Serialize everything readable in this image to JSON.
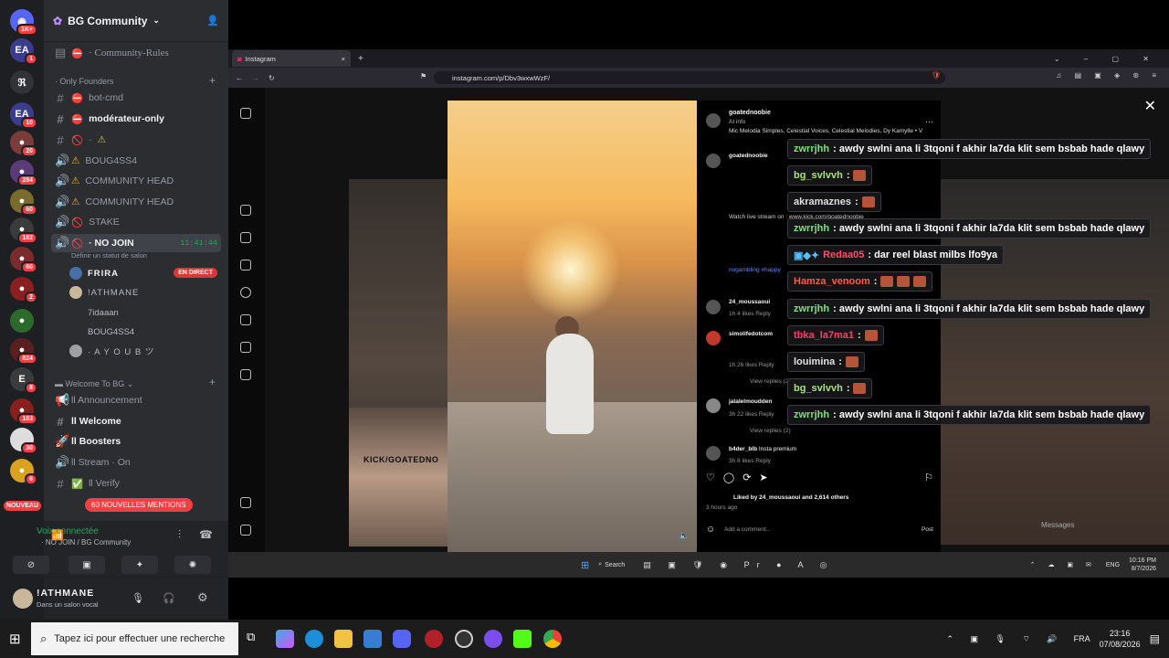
{
  "discord": {
    "guild_name": "BG Community",
    "channels": [
      {
        "name": "· Community-Rules",
        "icon": "rules-icon",
        "prefix": "⛔"
      },
      {
        "category": "· Only Founders"
      },
      {
        "name": "bot-cmd",
        "icon": "hash-icon",
        "prefix": "⛔"
      },
      {
        "name": "modérateur-only",
        "icon": "hash-icon",
        "prefix": "⛔",
        "bright": true
      },
      {
        "name": "·",
        "icon": "hash-icon",
        "prefix": "🚫",
        "extra": "⚠"
      },
      {
        "name": "BOUG4SS4",
        "icon": "speaker-icon",
        "prefix": "⚠"
      },
      {
        "name": "COMMUNITY HEAD",
        "icon": "speaker-icon",
        "prefix": "⚠"
      },
      {
        "name": "COMMUNITY HEAD",
        "icon": "speaker-icon",
        "prefix": "⚠"
      },
      {
        "name": "STAKE",
        "icon": "speaker-icon",
        "prefix": "🚫"
      },
      {
        "name": "· NO JOIN",
        "icon": "speaker-icon",
        "prefix": "🚫",
        "bright": true,
        "time": "11:41:44",
        "status": "Définir un statut de salon"
      }
    ],
    "voice_users": [
      {
        "name": "FRIRA",
        "live": "EN DIRECT"
      },
      {
        "name": "!ATHMANE"
      },
      {
        "name": "7idaaan"
      },
      {
        "name": "BOUG4SS4"
      },
      {
        "name": "· A Y O U B ツ"
      }
    ],
    "category2": "Welcome To BG",
    "channels2": [
      {
        "name": "ll Announcement",
        "icon": "announcement-icon"
      },
      {
        "name": "ll Welcome",
        "icon": "hash-icon"
      },
      {
        "name": "ll Boosters",
        "icon": "rocket-icon"
      },
      {
        "name": "ll Stream · On",
        "icon": "speaker-icon"
      },
      {
        "name": "ll Verify",
        "icon": "check-icon"
      }
    ],
    "mentions_pill": "60 NOUVELLES MENTIONS",
    "new_badge": "NOUVEAU",
    "voice_connected": "Voix connectée",
    "voice_channel": "· NO JOIN / BG Community",
    "user_name": "!ATHMANE",
    "user_status": "Dans un salon vocal",
    "server_badges": [
      "1K+",
      "1",
      "",
      "10",
      "20",
      "284",
      "60",
      "182",
      "60",
      "2",
      "824",
      "8",
      "183",
      "30",
      "6"
    ]
  },
  "browser": {
    "tab_title": "Instagram",
    "url": "instagram.com/p/Dbv3wxwWzF/",
    "post": {
      "author": "goatednoobie",
      "audio": "AI info",
      "music": "Mic Melodia Simples, Celestial Voices, Celestial Melodies, Dy Kamylle • V",
      "caption_user": "goatednoobie",
      "watch_live": "Watch live stream on : www.kick.com/goatednoobie",
      "hashtags": "nogambling #happy",
      "comments": [
        {
          "user": "24_moussaoui",
          "meta": "1h   4 likes   Reply"
        },
        {
          "user": "simolifedotcom",
          "meta": "1h   26 likes   Reply"
        },
        {
          "user": "jalalelmoudden",
          "meta": "3h   22 likes   Reply"
        },
        {
          "user": "b4der_blb",
          "text": "Insta premium",
          "meta": "3h   8 likes   Reply"
        }
      ],
      "view_replies": "View replies (2)",
      "liked_by": "Liked by 24_moussaoui and 2,614 others",
      "time_ago": "3 hours ago",
      "add_comment": "Add a comment...",
      "post_btn": "Post",
      "messages": "Messages"
    },
    "cam_label": "KICK/GOATEDNO"
  },
  "chat": [
    {
      "user": "zwrrjhh",
      "color": "#7ee07b",
      "text": ": awdy swlni ana li 3tqoni f akhir la7da klit sem bsbab hade qlawy"
    },
    {
      "user": "bg_svlvvh",
      "color": "#a8e07b",
      "text": ":",
      "emotes": 1
    },
    {
      "user": "akramaznes",
      "color": "#e0e0e0",
      "text": ":",
      "emotes": 1
    },
    {
      "user": "zwrrjhh",
      "color": "#7ee07b",
      "text": ": awdy swlni ana li 3tqoni f akhir la7da klit sem bsbab hade qlawy"
    },
    {
      "user": "Redaa05",
      "color": "#ff4d6a",
      "text": ": dar reel blast milbs lfo9ya",
      "badges": true
    },
    {
      "user": "Hamza_venoom",
      "color": "#ff5a4a",
      "text": ":",
      "emotes": 3
    },
    {
      "user": "zwrrjhh",
      "color": "#7ee07b",
      "text": ": awdy swlni ana li 3tqoni f akhir la7da klit sem bsbab hade qlawy"
    },
    {
      "user": "tbka_la7ma1",
      "color": "#ff3b6b",
      "text": ":",
      "emotes": 1
    },
    {
      "user": "louimina",
      "color": "#e0e0e0",
      "text": ":",
      "emotes": 1
    },
    {
      "user": "bg_svlvvh",
      "color": "#a8e07b",
      "text": ":",
      "emotes": 1
    },
    {
      "user": "zwrrjhh",
      "color": "#7ee07b",
      "text": ": awdy swlni ana li 3tqoni f akhir la7da klit sem bsbab hade qlawy"
    }
  ],
  "inner_taskbar": {
    "search": "Search",
    "lang": "ENG",
    "time": "10:16 PM",
    "date": "8/7/2026"
  },
  "taskbar": {
    "search_placeholder": "Tapez ici pour effectuer une recherche",
    "lang": "FRA",
    "time": "23:16",
    "date": "07/08/2026"
  }
}
